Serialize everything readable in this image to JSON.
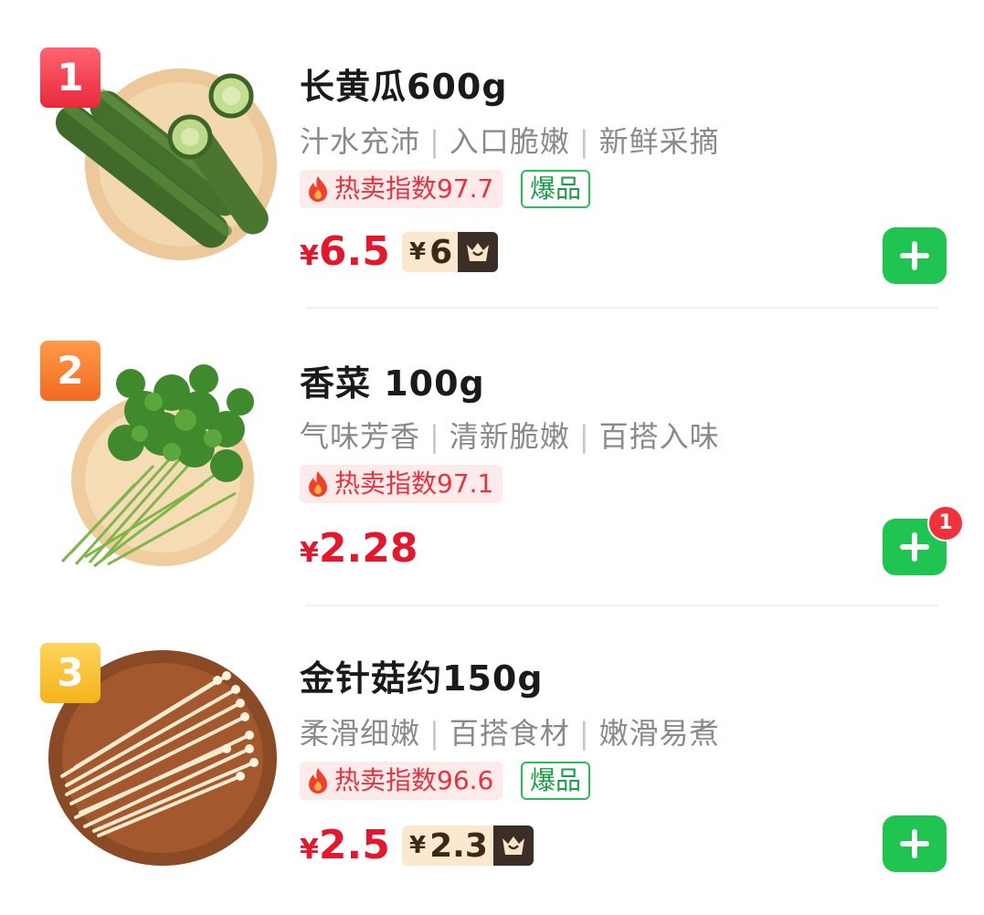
{
  "items": [
    {
      "rank": "1",
      "title": "长黄瓜600g",
      "tags": [
        "汁水充沛",
        "入口脆嫩",
        "新鲜采摘"
      ],
      "hot_label": "热卖指数97.7",
      "boom_label": "爆品",
      "price_currency": "¥",
      "price": "6.5",
      "vip_currency": "¥",
      "vip_price": "6",
      "image": "cucumber-image"
    },
    {
      "rank": "2",
      "title": "香菜 100g",
      "tags": [
        "气味芳香",
        "清新脆嫩",
        "百搭入味"
      ],
      "hot_label": "热卖指数97.1",
      "price_currency": "¥",
      "price": "2.28",
      "cart_count": "1",
      "image": "coriander-image"
    },
    {
      "rank": "3",
      "title": "金针菇约150g",
      "tags": [
        "柔滑细嫩",
        "百搭食材",
        "嫩滑易煮"
      ],
      "hot_label": "热卖指数96.6",
      "boom_label": "爆品",
      "price_currency": "¥",
      "price": "2.5",
      "vip_currency": "¥",
      "vip_price": "2.3",
      "image": "enoki-mushroom-image"
    }
  ],
  "colors": {
    "price": "#e5172c",
    "add_button": "#1fc550",
    "hot_bg": "#fdeaea",
    "boom_border": "#2ebc5b"
  },
  "icons": {
    "add": "plus-icon",
    "hot": "flame-icon",
    "vip": "vip-crown-icon"
  }
}
